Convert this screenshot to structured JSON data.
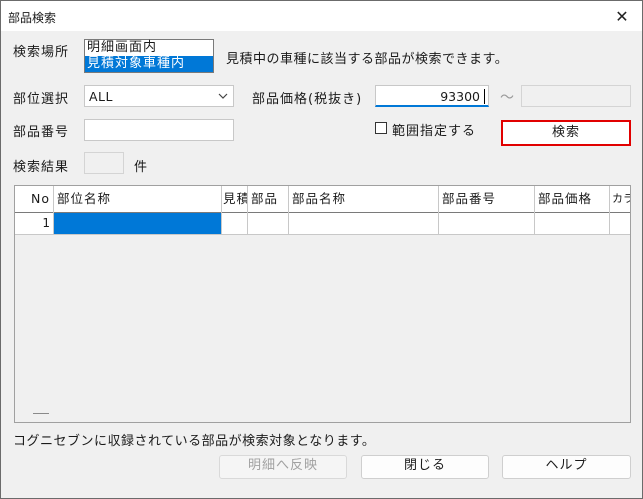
{
  "window": {
    "title": "部品検索",
    "close_glyph": "✕"
  },
  "search_location": {
    "label": "検索場所",
    "options": [
      "明細画面内",
      "見積対象車種内"
    ],
    "selected_index": 1,
    "description": "見積中の車種に該当する部品が検索できます。"
  },
  "part_position": {
    "label": "部位選択",
    "value": "ALL"
  },
  "part_price": {
    "label": "部品価格(税抜き)",
    "value": "93300",
    "range_separator": "～",
    "range_to_value": ""
  },
  "part_number": {
    "label": "部品番号",
    "value": ""
  },
  "range": {
    "label": "範囲指定する",
    "checked": false
  },
  "search_button": {
    "label": "検索"
  },
  "result_count": {
    "label": "検索結果",
    "value": "",
    "unit": "件"
  },
  "results_table": {
    "columns": [
      "No",
      "部位名称",
      "見積",
      "部品",
      "部品名称",
      "部品番号",
      "部品価格",
      "カラ"
    ],
    "rows": [
      {
        "no": "1",
        "cells": [
          "",
          "",
          "",
          "",
          "",
          "",
          ""
        ]
      }
    ]
  },
  "footer": {
    "note": "コグニセブンに収録されている部品が検索対象となります。",
    "reflect_button": "明細へ反映",
    "close_button": "閉じる",
    "help_button": "ヘルプ"
  },
  "colors": {
    "selection": "#0078d7",
    "highlight_border": "#e10000"
  }
}
